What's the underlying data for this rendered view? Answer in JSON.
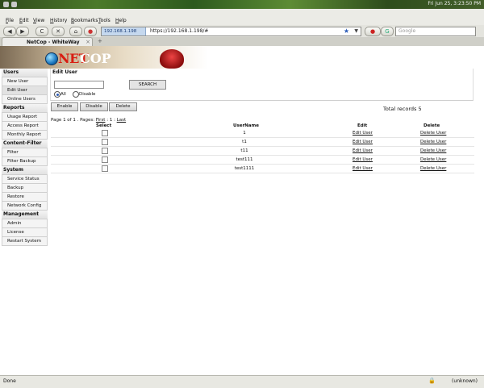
{
  "panel": {
    "clock": "Fri Jun 25, 3:23:50 PM"
  },
  "menubar": {
    "items": [
      "File",
      "Edit",
      "View",
      "History",
      "Bookmarks",
      "Tools",
      "Help"
    ]
  },
  "nav": {
    "url_badge": "192.168.1.198",
    "url": "https://192.168.1.198/#",
    "search_placeholder": "Google",
    "back": "◀",
    "forward": "▶",
    "reload": "C",
    "stop": "✕",
    "home": "⌂"
  },
  "tab": {
    "title": "NetCop - WhiteWay",
    "close": "×"
  },
  "brand": {
    "net": "NET",
    "cop": "COP"
  },
  "sidebar": {
    "sections": [
      {
        "title": "Users",
        "items": [
          "New User",
          "Edit User",
          "Online Users"
        ]
      },
      {
        "title": "Reports",
        "items": [
          "Usage Report",
          "Access Report",
          "Monthly Report"
        ]
      },
      {
        "title": "Content-Filter",
        "items": [
          "Filter",
          "Filter Backup"
        ]
      },
      {
        "title": "System",
        "items": [
          "Service Status",
          "Backup",
          "Restore",
          "Network Config"
        ]
      },
      {
        "title": "Management",
        "items": [
          "Admin",
          "License",
          "Restart System"
        ]
      }
    ]
  },
  "main": {
    "heading": "Edit User",
    "search_value": "",
    "search_button": "SEARCH",
    "radio_all": "All",
    "radio_disable": "Disable",
    "buttons": {
      "enable": "Enable",
      "disable": "Disable",
      "delete": "Delete"
    },
    "total": "Total records 5",
    "pager": {
      "prefix": "Page 1 of 1 . Pages: ",
      "first": "First",
      "mid": " : 1 : ",
      "last": "Last"
    },
    "columns": [
      "Select",
      "UserName",
      "Edit",
      "Delete"
    ],
    "rows": [
      {
        "username": "1",
        "edit": "Edit User",
        "delete": "Delete User"
      },
      {
        "username": "t1",
        "edit": "Edit User",
        "delete": "Delete User"
      },
      {
        "username": "t11",
        "edit": "Edit User",
        "delete": "Delete User"
      },
      {
        "username": "test111",
        "edit": "Edit User",
        "delete": "Delete User"
      },
      {
        "username": "test1111",
        "edit": "Edit User",
        "delete": "Delete User"
      }
    ]
  },
  "status": {
    "left": "Done",
    "right": "(unknown)"
  }
}
